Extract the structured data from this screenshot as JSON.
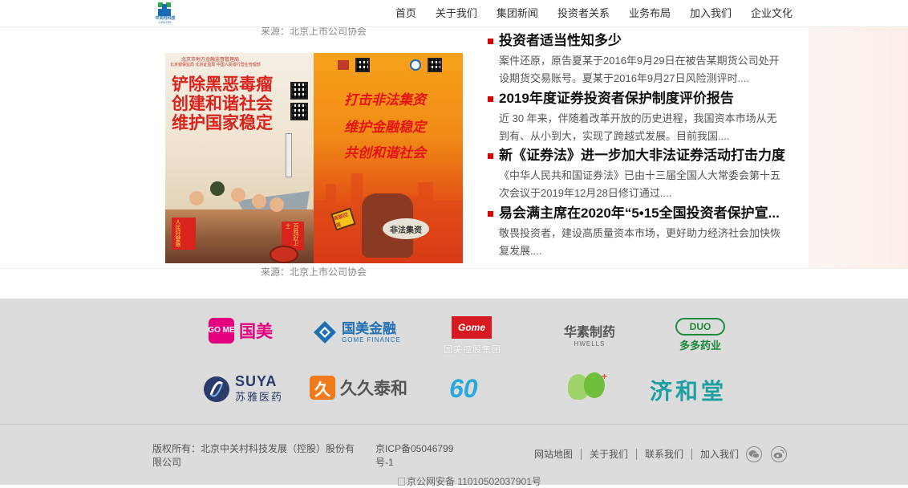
{
  "header": {
    "logo_cn": "中关村科技",
    "logo_en": "CENTEK",
    "nav": [
      "首页",
      "关于我们",
      "集团新闻",
      "投资者关系",
      "业务布局",
      "加入我们",
      "企业文化"
    ]
  },
  "content": {
    "source_top": "来源：北京上市公司协会",
    "source_bottom": "来源：北京上市公司协会",
    "poster_a": {
      "slogans": [
        "铲除黑恶毒瘤",
        "创建和谐社会",
        "维护国家稳定"
      ],
      "small_text": [
        "北京市地方金融监督管理局",
        "北京银保监局 北京证监局 中国人民银行营业管理部"
      ],
      "banner_left": "人民好警察",
      "banner_right": "百姓好卫士"
    },
    "poster_b": {
      "slogans": [
        "打击非法集资",
        "维护金融稳定",
        "共创和谐社会"
      ],
      "sign": "高额回报",
      "bag": "非法集资"
    },
    "news": [
      {
        "title": "投资者适当性知多少",
        "desc": "案件还原，原告夏某于2016年9月29日在被告某期货公司处开设期货交易账号。夏某于2016年9月27日风险测评时...."
      },
      {
        "title": "2019年度证券投资者保护制度评价报告",
        "desc": "近 30 年来，伴随着改革开放的历史进程，我国资本市场从无到有、从小到大，实现了跨越式发展。目前我国...."
      },
      {
        "title": "新《证券法》进一步加大非法证券活动打击力度",
        "desc": "《中华人民共和国证券法》已由十三届全国人大常委会第十五次会议于2019年12月28日修订通过...."
      },
      {
        "title": "易会满主席在2020年“5•15全国投资者保护宣...",
        "desc": "敬畏投资者，建设高质量资本市场，更好助力经济社会加快恢复发展...."
      }
    ]
  },
  "partners": {
    "gome_box": "GO ME",
    "gome": "国美",
    "gome_finance": "国美金融",
    "gome_finance_en": "GOME FINANCE",
    "gome_holding_box": "Gome",
    "gome_holding": "国美控股集团",
    "huasu": "华素制药",
    "huasu_en": "HWELLS",
    "duoduo_en": "DUO",
    "duoduo": "多多药业",
    "suya_en": "SUYA",
    "suya": "苏雅医药",
    "jiujiu_box": "久",
    "jiujiu": "久久泰和",
    "sixty": "60",
    "jihetang": "济和堂"
  },
  "footer": {
    "copyright": "版权所有：北京中关村科技发展（控股）股份有限公司",
    "icp": "京ICP备05046799号-1",
    "links": [
      "网站地图",
      "关于我们",
      "联系我们",
      "加入我们"
    ],
    "police": "京公网安备 11010502037901号"
  },
  "colors": {
    "accent_red": "#d20000",
    "gome_pink": "#e5007f",
    "finance_blue": "#1f6fb5",
    "gray_band": "#dcdcdc"
  },
  "icons": [
    "wechat-icon",
    "weibo-icon"
  ]
}
